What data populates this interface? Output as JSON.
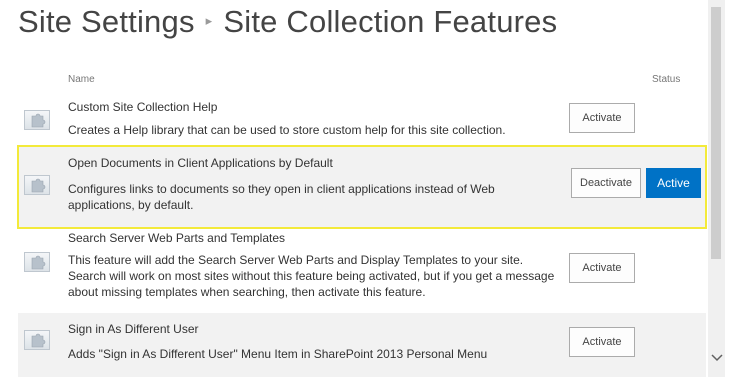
{
  "page": {
    "title_parent": "Site Settings",
    "title_separator": "▸",
    "title_current": "Site Collection Features"
  },
  "columns": {
    "name": "Name",
    "status": "Status"
  },
  "features": [
    {
      "name": "Custom Site Collection Help",
      "description": "Creates a Help library that can be used to store custom help for this site collection.",
      "button_label": "Activate",
      "status": "",
      "icon": "feature-puzzle-icon"
    },
    {
      "name": "Open Documents in Client Applications by Default",
      "description": "Configures links to documents so they open in client applications instead of Web applications, by default.",
      "button_label": "Deactivate",
      "status": "Active",
      "icon": "feature-puzzle-icon"
    },
    {
      "name": "Search Server Web Parts and Templates",
      "description": "This feature will add the Search Server Web Parts and Display Templates to your site. Search will work on most sites without this feature being activated, but if you get a message about missing templates when searching, then activate this feature.",
      "button_label": "Activate",
      "status": "",
      "icon": "feature-puzzle-icon"
    },
    {
      "name": "Sign in As Different User",
      "description": "Adds \"Sign in As Different User\" Menu Item in SharePoint 2013 Personal Menu",
      "button_label": "Activate",
      "status": "",
      "icon": "feature-puzzle-icon"
    }
  ],
  "colors": {
    "active_status": "#0072c6",
    "highlight_outline": "#f3ea3a",
    "row_shade": "#f2f2f2"
  }
}
